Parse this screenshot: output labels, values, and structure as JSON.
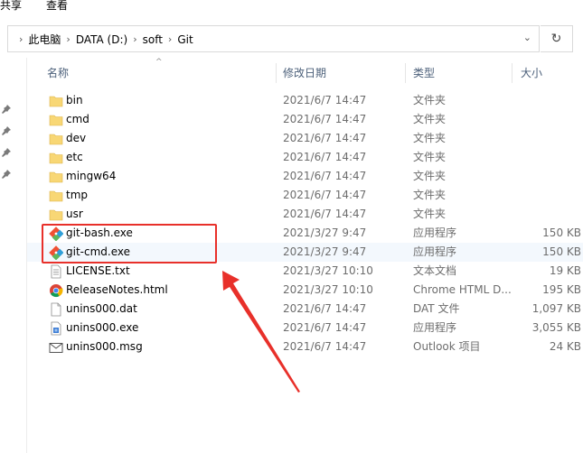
{
  "ribbon": {
    "tabs": [
      "共享",
      "查看"
    ]
  },
  "address": {
    "crumbs": [
      "此电脑",
      "DATA (D:)",
      "soft",
      "Git"
    ],
    "sep": "›",
    "dropdown_icon": "⌄",
    "refresh_icon": "↻"
  },
  "columns": {
    "name": "名称",
    "date": "修改日期",
    "type": "类型",
    "size": "大小",
    "sort_icon": "^"
  },
  "files": [
    {
      "name": "bin",
      "date": "2021/6/7 14:47",
      "type": "文件夹",
      "size": "",
      "icon": "folder-icon"
    },
    {
      "name": "cmd",
      "date": "2021/6/7 14:47",
      "type": "文件夹",
      "size": "",
      "icon": "folder-icon"
    },
    {
      "name": "dev",
      "date": "2021/6/7 14:47",
      "type": "文件夹",
      "size": "",
      "icon": "folder-icon"
    },
    {
      "name": "etc",
      "date": "2021/6/7 14:47",
      "type": "文件夹",
      "size": "",
      "icon": "folder-icon"
    },
    {
      "name": "mingw64",
      "date": "2021/6/7 14:47",
      "type": "文件夹",
      "size": "",
      "icon": "folder-icon"
    },
    {
      "name": "tmp",
      "date": "2021/6/7 14:47",
      "type": "文件夹",
      "size": "",
      "icon": "folder-icon"
    },
    {
      "name": "usr",
      "date": "2021/6/7 14:47",
      "type": "文件夹",
      "size": "",
      "icon": "folder-icon"
    },
    {
      "name": "git-bash.exe",
      "date": "2021/3/27 9:47",
      "type": "应用程序",
      "size": "150 KB",
      "icon": "git-icon"
    },
    {
      "name": "git-cmd.exe",
      "date": "2021/3/27 9:47",
      "type": "应用程序",
      "size": "150 KB",
      "icon": "git-icon"
    },
    {
      "name": "LICENSE.txt",
      "date": "2021/3/27 10:10",
      "type": "文本文档",
      "size": "19 KB",
      "icon": "text-file-icon"
    },
    {
      "name": "ReleaseNotes.html",
      "date": "2021/3/27 10:10",
      "type": "Chrome HTML D...",
      "size": "195 KB",
      "icon": "chrome-icon"
    },
    {
      "name": "unins000.dat",
      "date": "2021/6/7 14:47",
      "type": "DAT 文件",
      "size": "1,097 KB",
      "icon": "blank-file-icon"
    },
    {
      "name": "unins000.exe",
      "date": "2021/6/7 14:47",
      "type": "应用程序",
      "size": "3,055 KB",
      "icon": "setup-icon"
    },
    {
      "name": "unins000.msg",
      "date": "2021/6/7 14:47",
      "type": "Outlook 项目",
      "size": "24 KB",
      "icon": "mail-icon"
    }
  ],
  "colors": {
    "highlight": "#e8302a",
    "folder": "#f8d775",
    "header_text": "#4c607a"
  }
}
